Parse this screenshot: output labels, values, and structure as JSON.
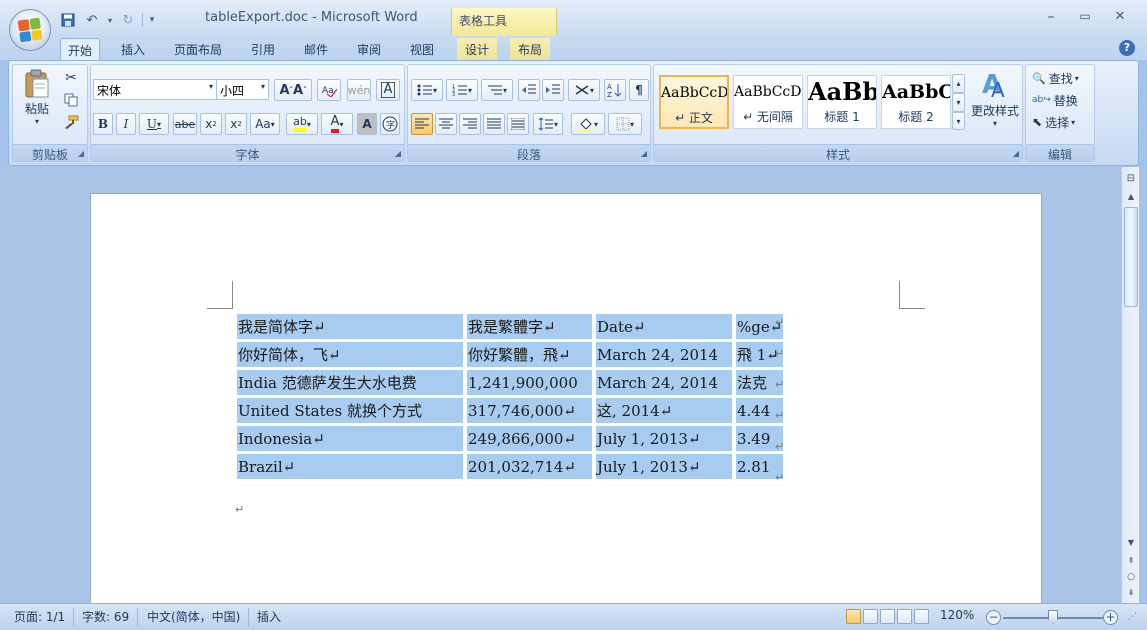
{
  "window": {
    "title": "tableExport.doc - Microsoft Word",
    "context_tab_group": "表格工具",
    "minimize": "–",
    "maximize": "▭",
    "close": "✕"
  },
  "tabs": [
    {
      "label": "开始",
      "active": true
    },
    {
      "label": "插入"
    },
    {
      "label": "页面布局"
    },
    {
      "label": "引用"
    },
    {
      "label": "邮件"
    },
    {
      "label": "审阅"
    },
    {
      "label": "视图"
    },
    {
      "label": "设计"
    },
    {
      "label": "布局"
    }
  ],
  "ribbon": {
    "clipboard": {
      "label": "剪贴板",
      "paste": "粘贴"
    },
    "font": {
      "label": "字体",
      "font_name": "宋体",
      "font_size": "小四"
    },
    "paragraph": {
      "label": "段落"
    },
    "styles": {
      "label": "样式",
      "items": [
        {
          "sample": "AaBbCcDc",
          "name": "↵ 正文"
        },
        {
          "sample": "AaBbCcDc",
          "name": "↵ 无间隔"
        },
        {
          "sample": "AaBb",
          "name": "标题 1"
        },
        {
          "sample": "AaBbC",
          "name": "标题 2"
        }
      ],
      "change_styles": "更改样式"
    },
    "editing": {
      "label": "编辑",
      "find": "查找",
      "replace": "替换",
      "select": "选择"
    }
  },
  "document": {
    "table": [
      [
        "我是简体字↵",
        "我是繁體字↵",
        "Date↵",
        "%ge↵"
      ],
      [
        "你好简体，飞↵",
        "你好繁體，飛↵",
        "March 24, 2014",
        "飛 1↵"
      ],
      [
        "India 范德萨发生大水电费",
        "1,241,900,000",
        "March 24, 2014",
        "法克"
      ],
      [
        "United States 就换个方式",
        "317,746,000↵",
        "这, 2014↵",
        "4.44"
      ],
      [
        "Indonesia↵",
        "249,866,000↵",
        "July 1, 2013↵",
        "3.49"
      ],
      [
        "Brazil↵",
        "201,032,714↵",
        "July 1, 2013↵",
        "2.81"
      ]
    ],
    "end_mark": "↵",
    "row_mark": "↵"
  },
  "status": {
    "page": "页面: 1/1",
    "words": "字数: 69",
    "language": "中文(简体，中国)",
    "mode": "插入",
    "zoom": "120%",
    "zoom_minus": "−",
    "zoom_plus": "+"
  }
}
